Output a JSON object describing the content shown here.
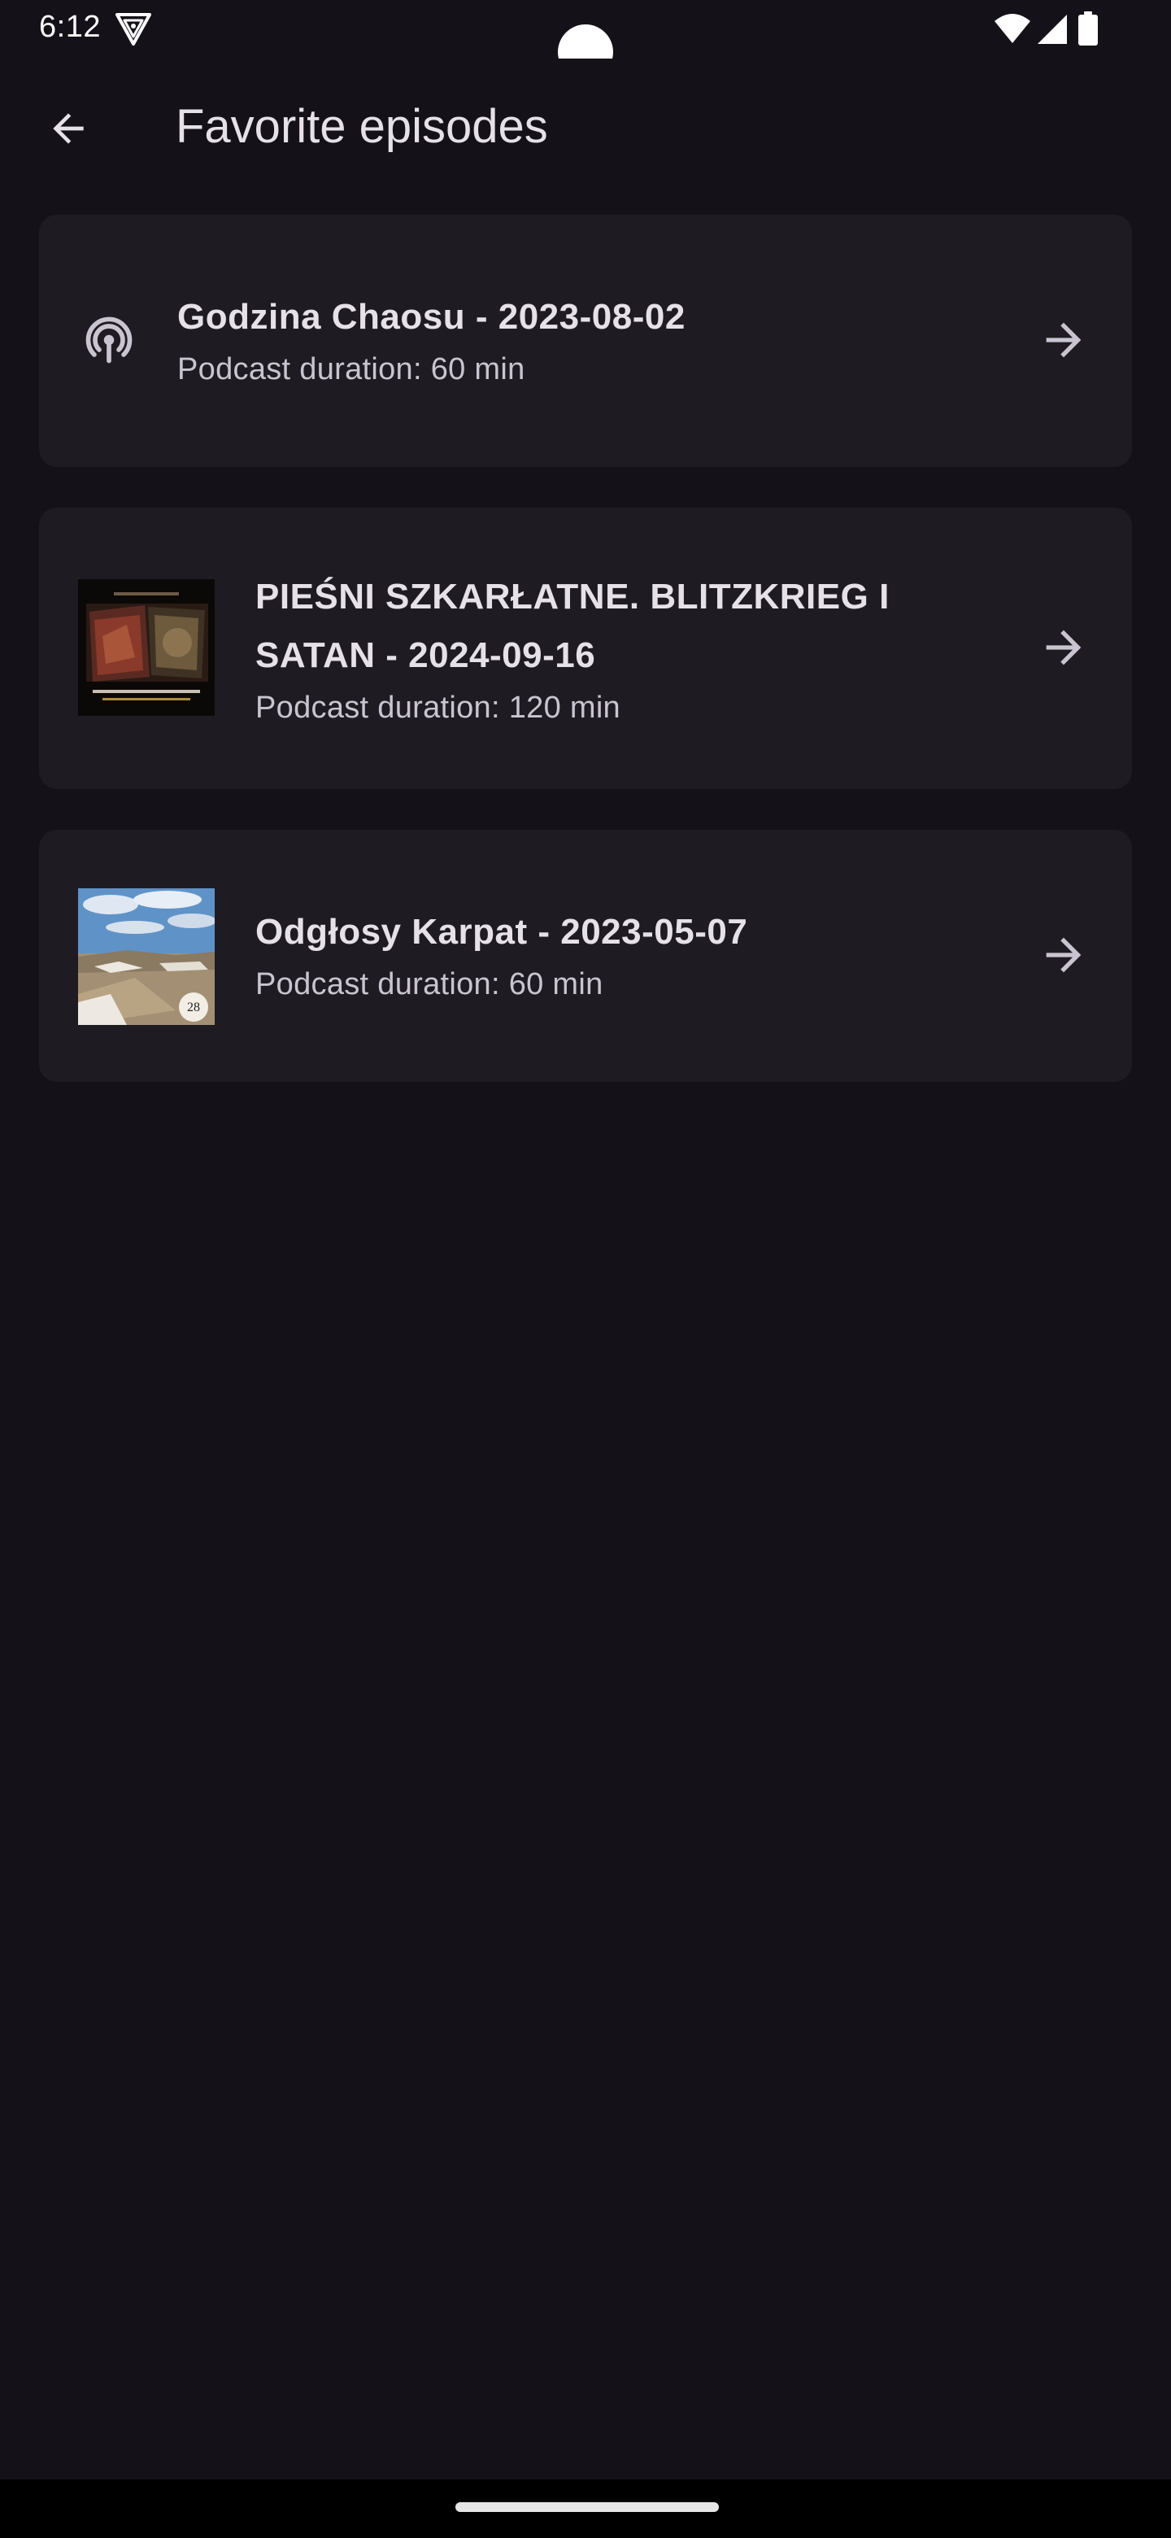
{
  "status_bar": {
    "time": "6:12",
    "icons": [
      "vpn-key-icon",
      "wifi-icon",
      "cellular-signal-icon",
      "battery-icon"
    ]
  },
  "app_bar": {
    "title": "Favorite episodes",
    "back_icon": "arrow-back-icon"
  },
  "episodes": [
    {
      "title": "Godzina Chaosu - 2023-08-02",
      "duration": "Podcast duration: 60 min",
      "leading": "podcast-icon",
      "trailing_icon": "arrow-forward-icon"
    },
    {
      "title": "PIEŚNI SZKARŁATNE. BLITZKRIEG I SATAN - 2024-09-16",
      "duration": "Podcast duration: 120 min",
      "leading": "episode-artwork",
      "trailing_icon": "arrow-forward-icon"
    },
    {
      "title": "Odgłosy Karpat - 2023-05-07",
      "duration": "Podcast duration: 60 min",
      "leading": "episode-artwork",
      "trailing_icon": "arrow-forward-icon"
    }
  ],
  "colors": {
    "background": "#141218",
    "card": "#1e1c22",
    "title_text": "#e6e0e9",
    "secondary_text": "#cac4d0",
    "icon": "#cac4d0"
  }
}
